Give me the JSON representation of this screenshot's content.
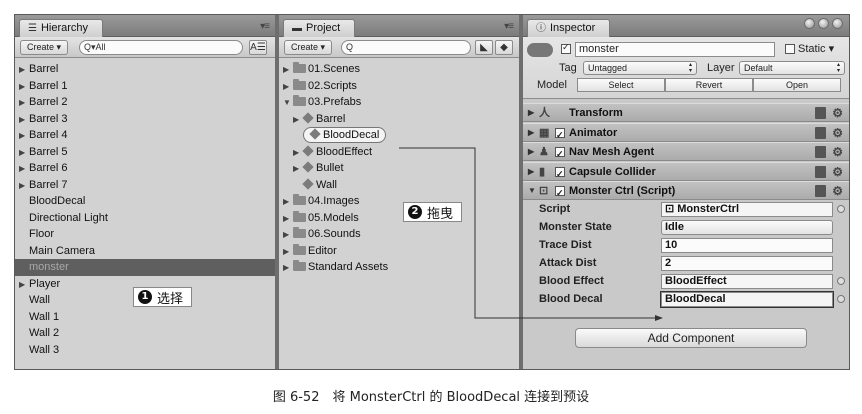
{
  "hierarchy": {
    "tab_label": "Hierarchy",
    "create_label": "Create ▾",
    "search_placeholder": "Q▾All",
    "items": [
      {
        "label": "Barrel",
        "expand": true
      },
      {
        "label": "Barrel 1",
        "expand": true
      },
      {
        "label": "Barrel 2",
        "expand": true
      },
      {
        "label": "Barrel 3",
        "expand": true
      },
      {
        "label": "Barrel 4",
        "expand": true
      },
      {
        "label": "Barrel 5",
        "expand": true
      },
      {
        "label": "Barrel 6",
        "expand": true
      },
      {
        "label": "Barrel 7",
        "expand": true
      },
      {
        "label": "BloodDecal",
        "expand": false
      },
      {
        "label": "Directional Light",
        "expand": false
      },
      {
        "label": "Floor",
        "expand": false
      },
      {
        "label": "Main Camera",
        "expand": false
      },
      {
        "label": "monster",
        "expand": false,
        "selected": true
      },
      {
        "label": "Player",
        "expand": true
      },
      {
        "label": "Wall",
        "expand": false
      },
      {
        "label": "Wall 1",
        "expand": false
      },
      {
        "label": "Wall 2",
        "expand": false
      },
      {
        "label": "Wall 3",
        "expand": false
      }
    ]
  },
  "project": {
    "tab_label": "Project",
    "create_label": "Create ▾",
    "search_placeholder": "Q",
    "items": [
      {
        "label": "01.Scenes",
        "kind": "folder",
        "indent": 0
      },
      {
        "label": "02.Scripts",
        "kind": "folder",
        "indent": 0
      },
      {
        "label": "03.Prefabs",
        "kind": "folder-open",
        "indent": 0
      },
      {
        "label": "Barrel",
        "kind": "prefab-exp",
        "indent": 1
      },
      {
        "label": "BloodDecal",
        "kind": "prefab-hl",
        "indent": 1
      },
      {
        "label": "BloodEffect",
        "kind": "prefab-exp",
        "indent": 1
      },
      {
        "label": "Bullet",
        "kind": "prefab-exp",
        "indent": 1
      },
      {
        "label": "Wall",
        "kind": "prefab",
        "indent": 1
      },
      {
        "label": "04.Images",
        "kind": "folder",
        "indent": 0
      },
      {
        "label": "05.Models",
        "kind": "folder",
        "indent": 0
      },
      {
        "label": "06.Sounds",
        "kind": "folder",
        "indent": 0
      },
      {
        "label": "Editor",
        "kind": "folder",
        "indent": 0
      },
      {
        "label": "Standard Assets",
        "kind": "folder",
        "indent": 0
      }
    ]
  },
  "inspector": {
    "tab_label": "Inspector",
    "object_name": "monster",
    "static_label": "Static ▾",
    "tag_label": "Tag",
    "tag_value": "Untagged",
    "layer_label": "Layer",
    "layer_value": "Default",
    "model_label": "Model",
    "model_buttons": [
      "Select",
      "Revert",
      "Open"
    ],
    "components": [
      {
        "name": "Transform",
        "icon": "人",
        "check": false
      },
      {
        "name": "Animator",
        "icon": "▦",
        "check": true
      },
      {
        "name": "Nav Mesh Agent",
        "icon": "♟",
        "check": true
      },
      {
        "name": "Capsule Collider",
        "icon": "▮",
        "check": true
      },
      {
        "name": "Monster Ctrl (Script)",
        "icon": "⊡",
        "check": true,
        "expanded": true
      }
    ],
    "properties": [
      {
        "label": "Script",
        "value": "⊡ MonsterCtrl",
        "type": "obj"
      },
      {
        "label": "Monster State",
        "value": "Idle",
        "type": "dropdown"
      },
      {
        "label": "Trace Dist",
        "value": "10",
        "type": "num"
      },
      {
        "label": "Attack Dist",
        "value": "2",
        "type": "num"
      },
      {
        "label": "Blood Effect",
        "value": "BloodEffect",
        "type": "obj"
      },
      {
        "label": "Blood Decal",
        "value": "BloodDecal",
        "type": "obj"
      }
    ],
    "add_component_label": "Add Component"
  },
  "callouts": {
    "select": {
      "num": "1",
      "text": "选择"
    },
    "drag": {
      "num": "2",
      "text": "拖曳"
    }
  },
  "caption": "图 6-52　将 MonsterCtrl 的 BloodDecal 连接到预设"
}
